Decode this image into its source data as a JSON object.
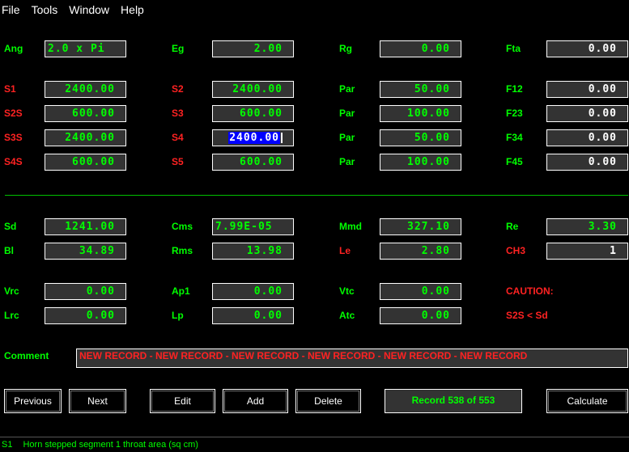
{
  "menu": [
    "File",
    "Tools",
    "Window",
    "Help"
  ],
  "rows": {
    "r1": [
      {
        "label": "Ang",
        "value": "2.0 x Pi"
      },
      {
        "label": "Eg",
        "value": "2.00"
      },
      {
        "label": "Rg",
        "value": "0.00"
      },
      {
        "label": "Fta",
        "value": "0.00"
      }
    ],
    "r2": [
      {
        "label": "S1",
        "value": "2400.00"
      },
      {
        "label": "S2",
        "value": "2400.00"
      },
      {
        "label": "Par",
        "value": "50.00"
      },
      {
        "label": "F12",
        "value": "0.00"
      }
    ],
    "r3": [
      {
        "label": "S2S",
        "value": "600.00"
      },
      {
        "label": "S3",
        "value": "600.00"
      },
      {
        "label": "Par",
        "value": "100.00"
      },
      {
        "label": "F23",
        "value": "0.00"
      }
    ],
    "r4": [
      {
        "label": "S3S",
        "value": "2400.00"
      },
      {
        "label": "S4",
        "value": "2400.00"
      },
      {
        "label": "Par",
        "value": "50.00"
      },
      {
        "label": "F34",
        "value": "0.00"
      }
    ],
    "r5": [
      {
        "label": "S4S",
        "value": "600.00"
      },
      {
        "label": "S5",
        "value": "600.00"
      },
      {
        "label": "Par",
        "value": "100.00"
      },
      {
        "label": "F45",
        "value": "0.00"
      }
    ],
    "r6": [
      {
        "label": "Sd",
        "value": "1241.00"
      },
      {
        "label": "Cms",
        "value": "7.99E-05"
      },
      {
        "label": "Mmd",
        "value": "327.10"
      },
      {
        "label": "Re",
        "value": "3.30"
      }
    ],
    "r7": [
      {
        "label": "Bl",
        "value": "34.89"
      },
      {
        "label": "Rms",
        "value": "13.98"
      },
      {
        "label": "Le",
        "value": "2.80"
      },
      {
        "label": "CH3",
        "value": "1"
      }
    ],
    "r8": [
      {
        "label": "Vrc",
        "value": "0.00"
      },
      {
        "label": "Ap1",
        "value": "0.00"
      },
      {
        "label": "Vtc",
        "value": "0.00"
      }
    ],
    "r9": [
      {
        "label": "Lrc",
        "value": "0.00"
      },
      {
        "label": "Lp",
        "value": "0.00"
      },
      {
        "label": "Atc",
        "value": "0.00"
      }
    ]
  },
  "caution": {
    "title": "CAUTION:",
    "message": "S2S < Sd"
  },
  "comment": {
    "label": "Comment",
    "value": "NEW RECORD - NEW RECORD - NEW RECORD - NEW RECORD - NEW RECORD - NEW RECORD"
  },
  "buttons": {
    "previous": "Previous",
    "next": "Next",
    "edit": "Edit",
    "add": "Add",
    "delete": "Delete",
    "calculate": "Calculate"
  },
  "record_status": "Record 538 of 553",
  "status": {
    "field": "S1",
    "description": "Horn stepped segment 1 throat area (sq cm)"
  },
  "colors": {
    "label_green": "#00ff00",
    "label_red": "#ff2222",
    "field_bg": "#333333",
    "selection": "#0000ff",
    "divider": "#00c000"
  }
}
